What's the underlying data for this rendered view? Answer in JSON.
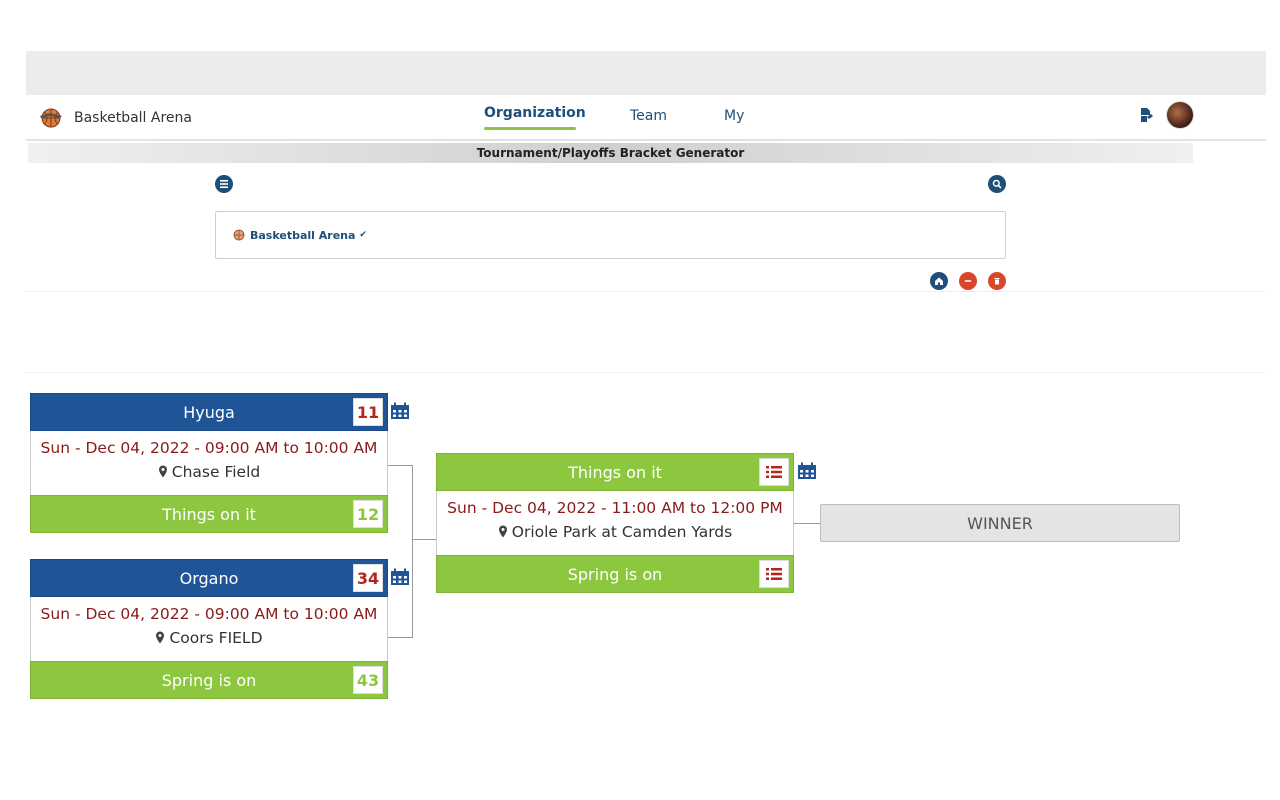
{
  "app": {
    "brand": "Basketball Arena"
  },
  "nav": {
    "tabs": [
      {
        "label": "Organization",
        "active": true
      },
      {
        "label": "Team",
        "active": false
      },
      {
        "label": "My",
        "active": false
      }
    ]
  },
  "page": {
    "title": "Tournament/Playoffs Bracket Generator"
  },
  "org": {
    "name": "Basketball Arena",
    "check": "✔"
  },
  "bracket": {
    "match1": {
      "team_top": "Hyuga",
      "score_top": "11",
      "date": "Sun - Dec 04, 2022 - 09:00 AM to 10:00 AM",
      "location": "Chase Field",
      "team_bottom": "Things on it",
      "score_bottom": "12"
    },
    "match2": {
      "team_top": "Organo",
      "score_top": "34",
      "date": "Sun - Dec 04, 2022 - 09:00 AM to 10:00 AM",
      "location": "Coors FIELD",
      "team_bottom": "Spring is on",
      "score_bottom": "43"
    },
    "match3": {
      "team_top": "Things on it",
      "date": "Sun - Dec 04, 2022 - 11:00 AM to 12:00 PM",
      "location": "Oriole Park at Camden Yards",
      "team_bottom": "Spring is on"
    },
    "winner_label": "WINNER"
  },
  "colors": {
    "primary": "#1f5597",
    "accent": "#8dc73f",
    "danger": "#d9472b",
    "date_text": "#8b1a1a"
  }
}
